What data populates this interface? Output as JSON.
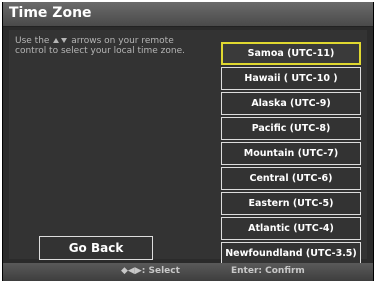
{
  "window": {
    "title": "Time Zone"
  },
  "instruction": {
    "before": "Use the",
    "after": "arrows on your remote control to select your local time zone."
  },
  "timezones": [
    {
      "label": "Samoa (UTC-11)",
      "selected": true
    },
    {
      "label": "Hawaii ( UTC-10 )",
      "selected": false
    },
    {
      "label": "Alaska (UTC-9)",
      "selected": false
    },
    {
      "label": "Pacific (UTC-8)",
      "selected": false
    },
    {
      "label": "Mountain (UTC-7)",
      "selected": false
    },
    {
      "label": "Central (UTC-6)",
      "selected": false
    },
    {
      "label": "Eastern (UTC-5)",
      "selected": false
    },
    {
      "label": "Atlantic (UTC-4)",
      "selected": false
    },
    {
      "label": "Newfoundland (UTC-3.5)",
      "selected": false
    }
  ],
  "go_back_label": "Go Back",
  "footer": {
    "select_hint": "◆◀▶: Select",
    "confirm_hint": "Enter: Confirm"
  },
  "colors": {
    "selection_border": "#e0d830",
    "background": "#2b2b2b"
  }
}
